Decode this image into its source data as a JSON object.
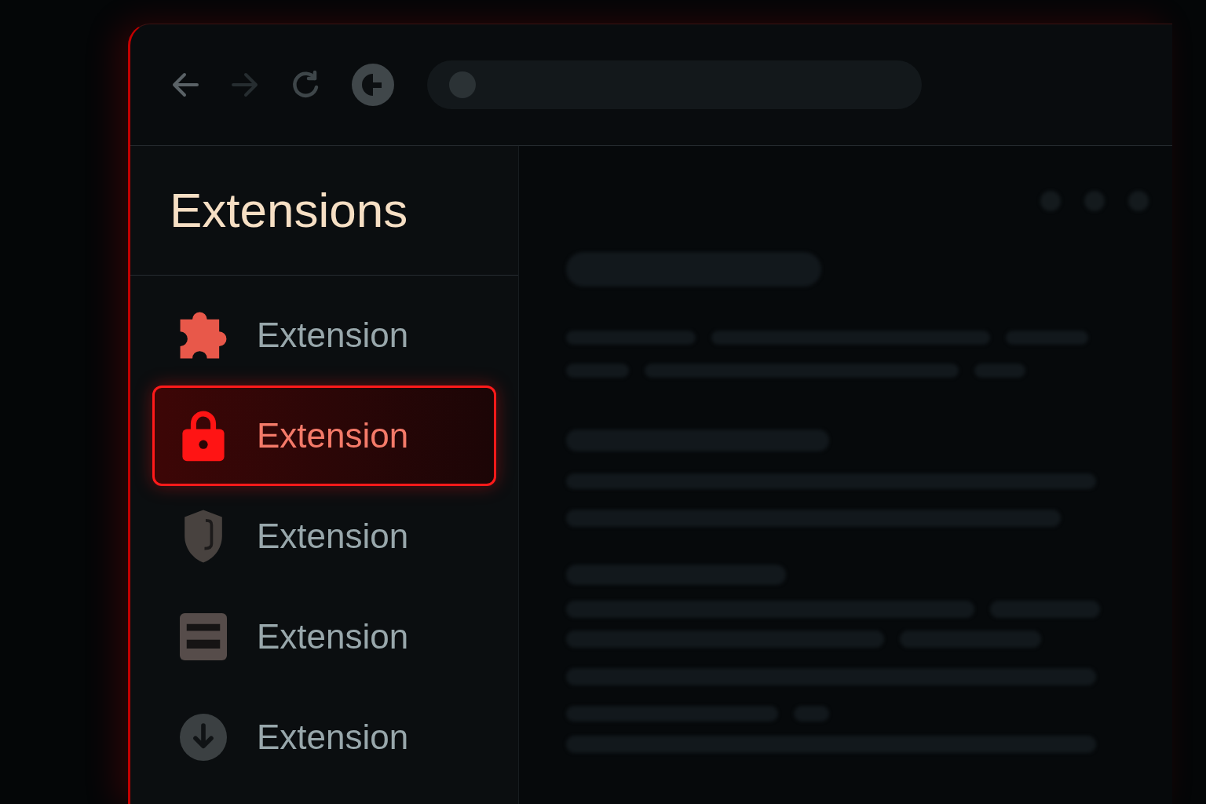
{
  "toolbar": {
    "buttons": [
      {
        "kind": "back",
        "disabled": false
      },
      {
        "kind": "forward",
        "disabled": true
      },
      {
        "kind": "reload",
        "disabled": false
      },
      {
        "kind": "site",
        "disabled": false
      }
    ]
  },
  "sidebar": {
    "title": "Extensions",
    "items": [
      {
        "label": "Extension",
        "selected": false
      },
      {
        "label": "Extension",
        "selected": true
      },
      {
        "label": "Extension",
        "selected": false
      },
      {
        "label": "Extension",
        "selected": false
      },
      {
        "label": "Extension",
        "selected": false
      }
    ]
  }
}
